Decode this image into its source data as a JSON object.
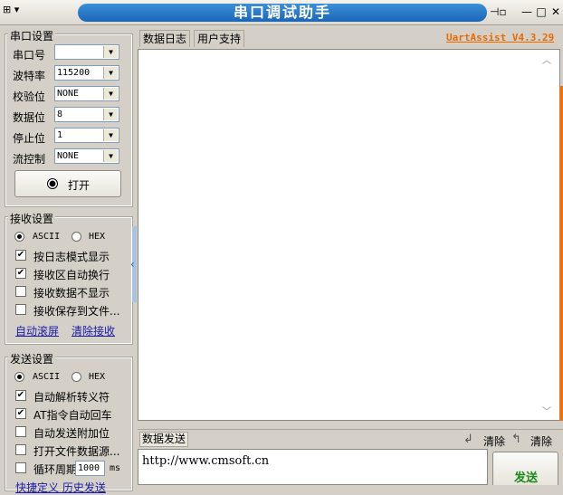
{
  "window": {
    "title": "串口调试助手",
    "sys_menu_glyph": "⊞ ▾",
    "pin_glyph": "⊣▫",
    "minimize_glyph": "—",
    "maximize_glyph": "□",
    "close_glyph": "✕",
    "brand": "UartAssist V4.3.29"
  },
  "serial_settings": {
    "title": "串口设置",
    "fields": [
      {
        "label": "串口号",
        "value": ""
      },
      {
        "label": "波特率",
        "value": "115200"
      },
      {
        "label": "校验位",
        "value": "NONE"
      },
      {
        "label": "数据位",
        "value": "8"
      },
      {
        "label": "停止位",
        "value": "1"
      },
      {
        "label": "流控制",
        "value": "NONE"
      }
    ],
    "open_button": "打开"
  },
  "receive_settings": {
    "title": "接收设置",
    "ascii": "ASCII",
    "hex": "HEX",
    "options": [
      {
        "label": "按日志模式显示",
        "checked": true
      },
      {
        "label": "接收区自动换行",
        "checked": true
      },
      {
        "label": "接收数据不显示",
        "checked": false
      },
      {
        "label": "接收保存到文件...",
        "checked": false
      }
    ],
    "auto_scroll": "自动滚屏",
    "clear_receive": "清除接收"
  },
  "send_settings": {
    "title": "发送设置",
    "ascii": "ASCII",
    "hex": "HEX",
    "options": [
      {
        "label": "自动解析转义符",
        "checked": true
      },
      {
        "label": "AT指令自动回车",
        "checked": true
      },
      {
        "label": "自动发送附加位",
        "checked": false
      },
      {
        "label": "打开文件数据源...",
        "checked": false
      }
    ],
    "loop_label": "循环周期",
    "loop_value": "1000",
    "loop_unit": "ms",
    "bottom_links": "快捷定义    历史发送"
  },
  "tabs": [
    "数据日志",
    "用户支持"
  ],
  "send_panel": {
    "label": "数据发送",
    "clear1": "清除",
    "clear2": "清除",
    "text": "http://www.cmsoft.cn",
    "send_button": "发送"
  },
  "colors": {
    "title_blue": "#1b66b8",
    "brand_orange": "#e86a00",
    "send_green": "#1a8a1a"
  }
}
